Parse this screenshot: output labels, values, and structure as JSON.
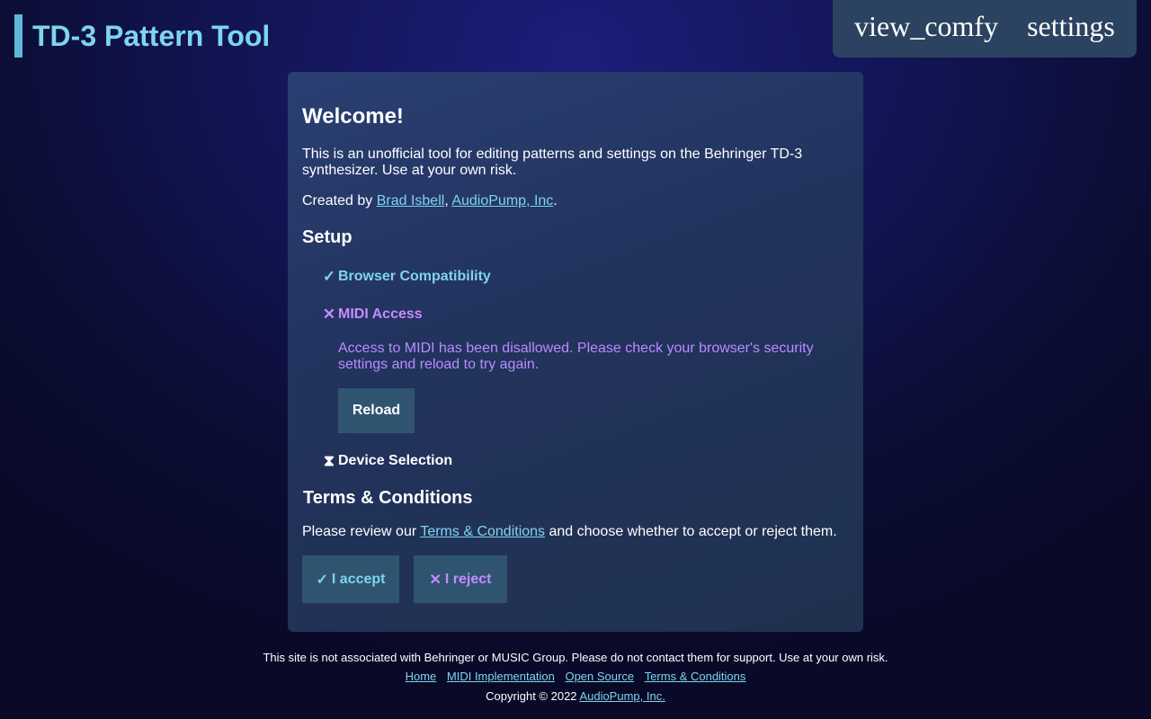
{
  "header": {
    "title": "TD-3 Pattern Tool",
    "toolbar": {
      "view_label": "view_comfy",
      "settings_label": "settings"
    }
  },
  "welcome": {
    "title": "Welcome!",
    "intro": "This is an unofficial tool for editing patterns and settings on the Behringer TD-3 synthesizer. Use at your own risk.",
    "created_prefix": "Created by ",
    "author": "Brad Isbell",
    "separator": ", ",
    "company": "AudioPump, Inc",
    "created_suffix": "."
  },
  "setup": {
    "title": "Setup",
    "steps": [
      {
        "mark": "✓",
        "label": "Browser Compatibility",
        "status": "ok"
      },
      {
        "mark": "✕",
        "label": "MIDI Access",
        "status": "failed"
      },
      {
        "mark": "⧗",
        "label": "Device Selection",
        "status": "pending"
      }
    ],
    "midi_error": "Access to MIDI has been disallowed. Please check your browser's security settings and reload to try again.",
    "reload_label": "Reload"
  },
  "terms": {
    "title": "Terms & Conditions",
    "prefix": "Please review our ",
    "link": "Terms & Conditions",
    "suffix": " and choose whether to accept or reject them.",
    "accept_mark": "✓",
    "accept_label": "I accept",
    "reject_mark": "✕",
    "reject_label": "I reject"
  },
  "footer": {
    "disclaimer": "This site is not associated with Behringer or MUSIC Group. Please do not contact them for support. Use at your own risk.",
    "links": [
      "Home",
      "MIDI Implementation",
      "Open Source",
      "Terms & Conditions"
    ],
    "copyright_prefix": "Copyright © 2022 ",
    "copyright_link": "AudioPump, Inc."
  },
  "colors": {
    "accent_cyan": "#7fd4ee",
    "accent_purple": "#c58bff",
    "button_bg": "#2f5470",
    "card_bg": "#22335e"
  }
}
